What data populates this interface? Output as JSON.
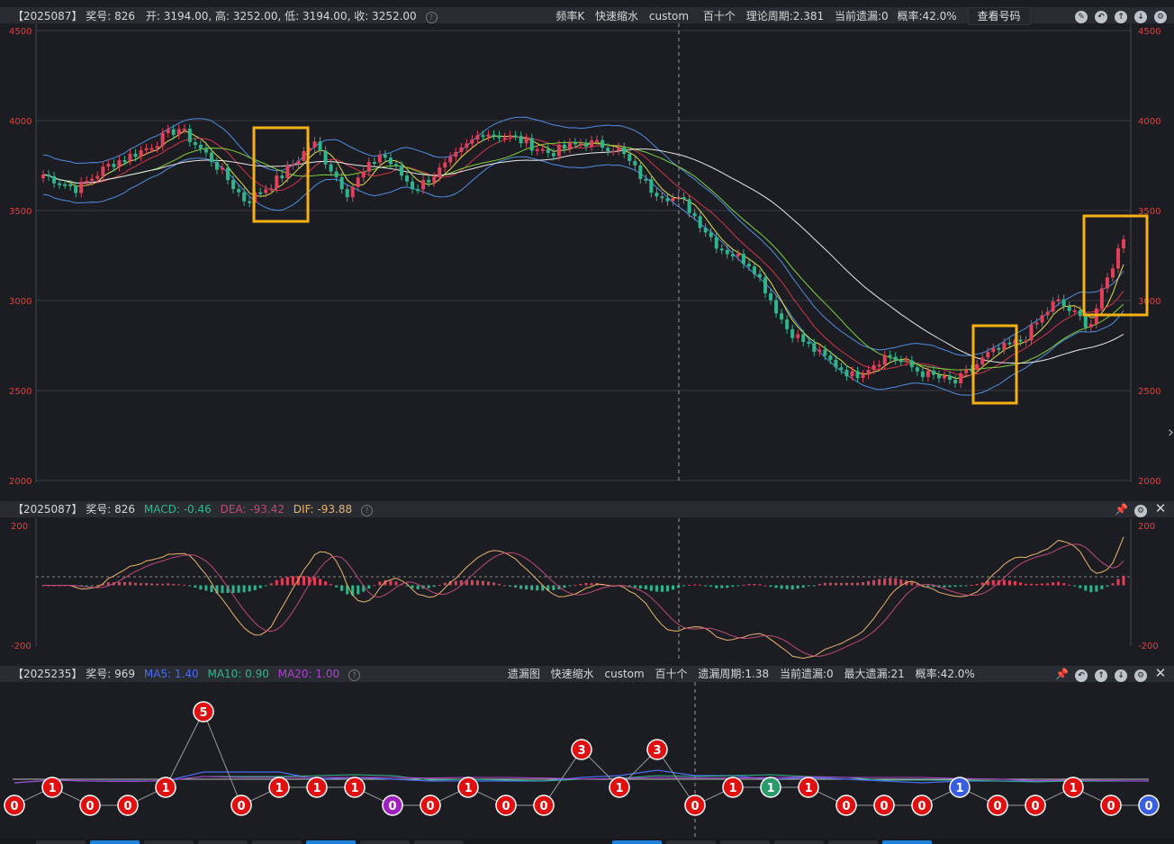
{
  "main_header": {
    "issue": "【2025087】",
    "prize_label": "奖号: 826",
    "ohlc": "开: 3194.00, 高: 3252.00, 低: 3194.00, 收: 3252.00",
    "chart_kind": "频率K",
    "mode": "快速缩水",
    "custom": "custom",
    "position": "百十个",
    "period": "理论周期:2.381",
    "current_miss": "当前遗漏:0",
    "probability": "概率:42.0%",
    "view_button": "查看号码"
  },
  "main_axis": {
    "ticks": [
      "4500",
      "4000",
      "3500",
      "3000",
      "2500",
      "2000"
    ],
    "range": [
      2000,
      4500
    ]
  },
  "macd_header": {
    "issue": "【2025087】",
    "prize_label": "奖号: 826",
    "macd": "MACD: -0.46",
    "dea": "DEA: -93.42",
    "dif": "DIF: -93.88"
  },
  "macd_axis": {
    "ticks": [
      "200",
      "-200"
    ],
    "range": [
      -200,
      200
    ]
  },
  "miss_header": {
    "issue": "【2025235】",
    "prize_label": "奖号: 969",
    "ma5": "MA5: 1.40",
    "ma10": "MA10: 0.90",
    "ma20": "MA20: 1.00",
    "chart_kind": "遗漏图",
    "mode": "快速缩水",
    "custom": "custom",
    "position": "百十个",
    "miss_period": "遗漏周期:1.38",
    "current_miss": "当前遗漏:0",
    "max_miss": "最大遗漏:21",
    "probability": "概率:42.0%"
  },
  "colors": {
    "up": "#e0405a",
    "down": "#2fb58c",
    "ma_white": "#e8e8e8",
    "ma_green": "#7fd23a",
    "ma_red": "#d2344a",
    "ma_yellow": "#e6e04a",
    "boll": "#4f8fe0",
    "highlight": "#f5b014",
    "macd_ma5": "#4a6cf0",
    "macd_ma10": "#2fb58c",
    "macd_ma20": "#b040d0"
  },
  "chart_data": [
    {
      "type": "candlestick",
      "title": "频率K",
      "ylim": [
        2000,
        4500
      ],
      "close_trend": [
        3700,
        3620,
        3760,
        3840,
        3960,
        3780,
        3550,
        3680,
        3880,
        3600,
        3820,
        3620,
        3760,
        3940,
        3900,
        3820,
        3880,
        3850,
        3620,
        3540,
        3300,
        3200,
        2850,
        2700,
        2580,
        2700,
        2600,
        2540,
        2700,
        2780,
        3000,
        2860,
        3360
      ]
    },
    {
      "type": "bar",
      "title": "MACD",
      "ylim": [
        -200,
        200
      ],
      "macd": -0.46,
      "dea": -93.42,
      "dif": -93.88
    },
    {
      "type": "scatter",
      "title": "遗漏图",
      "values": [
        0,
        1,
        0,
        0,
        1,
        5,
        0,
        1,
        1,
        1,
        0,
        0,
        1,
        0,
        0,
        3,
        1,
        3,
        0,
        1,
        1,
        1,
        0,
        0,
        0,
        1,
        0,
        0,
        1,
        0,
        0
      ],
      "ma5": 1.4,
      "ma10": 0.9,
      "ma20": 1.0,
      "max_miss": 21
    }
  ]
}
